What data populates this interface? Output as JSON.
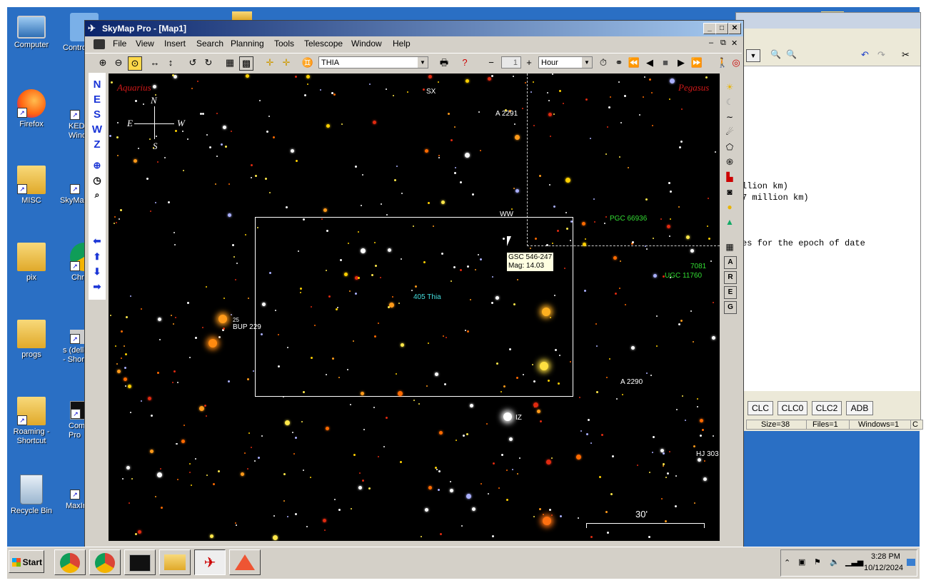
{
  "desktop": {
    "icons": [
      {
        "label": "Computer",
        "kind": "computer"
      },
      {
        "label": "Firefox",
        "kind": "firefox"
      },
      {
        "label": "MISC",
        "kind": "folder"
      },
      {
        "label": "pix",
        "kind": "folder"
      },
      {
        "label": "progs",
        "kind": "folder"
      },
      {
        "label": "Roaming - Shortcut",
        "kind": "folder"
      },
      {
        "label": "Recycle Bin",
        "kind": "recycle"
      }
    ],
    "partial_icons": [
      {
        "label": "Contro"
      },
      {
        "label": "KEDI Wind"
      },
      {
        "label": "SkyMap"
      },
      {
        "label": "Chr"
      },
      {
        "label": "s (dell- - Shor"
      },
      {
        "label": "Comr Pro"
      },
      {
        "label": "MaxIr"
      }
    ]
  },
  "back_window": {
    "lines": [
      "llion km)",
      "7 million km)",
      "es for the epoch of date"
    ],
    "buttons": [
      "CLC",
      "CLC0",
      "CLC2",
      "ADB"
    ],
    "status": [
      "Size=38",
      "Files=1",
      "Windows=1",
      "C"
    ]
  },
  "window": {
    "title": "SkyMap Pro - [Map1]",
    "menu": [
      "File",
      "View",
      "Insert",
      "Search",
      "Planning",
      "Tools",
      "Telescope",
      "Window",
      "Help"
    ],
    "object_combo": "THIA",
    "step_value": "1",
    "time_unit": "Hour"
  },
  "left_toolbar": {
    "letters": [
      "N",
      "E",
      "S",
      "W",
      "Z"
    ]
  },
  "map": {
    "constellation_left": "Aquarius",
    "constellation_right": "Pegasus",
    "compass": {
      "n": "N",
      "s": "S",
      "e": "E",
      "w": "W"
    },
    "labels": [
      {
        "text": "SX",
        "color": "#ffffff"
      },
      {
        "text": "A 2291",
        "color": "#ffffff"
      },
      {
        "text": "WW",
        "color": "#ffffff"
      },
      {
        "text": "PGC 66936",
        "color": "#33dd33"
      },
      {
        "text": "7081",
        "color": "#33dd33"
      },
      {
        "text": "UGC 11760",
        "color": "#33dd33"
      },
      {
        "text": "405 Thia",
        "color": "#44dddd"
      },
      {
        "text": "25",
        "color": "#ffffff"
      },
      {
        "text": "BUP 229",
        "color": "#ffffff"
      },
      {
        "text": "A 2290",
        "color": "#ffffff"
      },
      {
        "text": "IZ",
        "color": "#ffffff"
      },
      {
        "text": "HJ 303",
        "color": "#ffffff"
      }
    ],
    "tooltip": {
      "name": "GSC 546-247",
      "mag": "Mag: 14.03"
    },
    "scale": "30'"
  },
  "taskbar": {
    "start": "Start",
    "time": "3:28 PM",
    "date": "10/12/2024"
  }
}
